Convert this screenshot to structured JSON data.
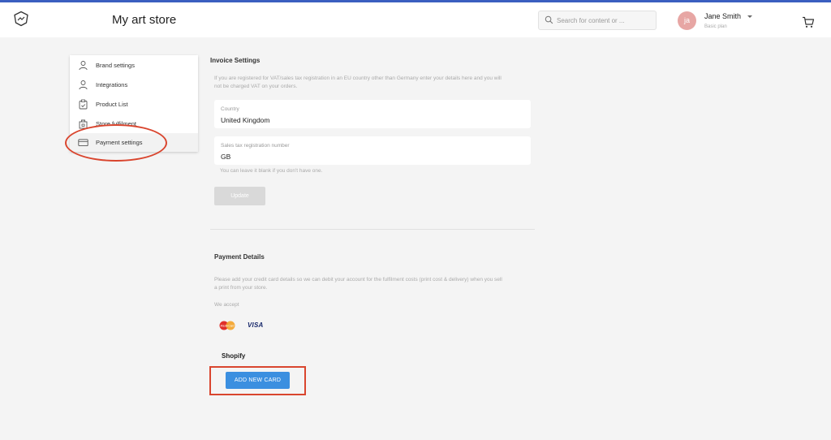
{
  "header": {
    "store_title": "My art store",
    "search": {
      "placeholder": "Search for content or ..."
    },
    "user": {
      "initials": "ja",
      "name": "Jane Smith",
      "plan": "Basic plan"
    }
  },
  "sidebar": {
    "items": [
      {
        "label": "Brand settings",
        "icon": "person-icon"
      },
      {
        "label": "Integrations",
        "icon": "person-icon"
      },
      {
        "label": "Product List",
        "icon": "clipboard-icon"
      },
      {
        "label": "Store fulfilment",
        "icon": "package-icon"
      },
      {
        "label": "Payment settings",
        "icon": "credit-card-icon",
        "active": true
      }
    ]
  },
  "invoice": {
    "title": "Invoice Settings",
    "description_line1": "If you are registered for VAT/sales tax registration in an EU country other than Germany enter your details here and you will",
    "description_line2": "not be charged VAT on your orders.",
    "country_label": "Country",
    "country_value": "United Kingdom",
    "tax_label": "Sales tax registration number",
    "tax_value": "GB",
    "tax_hint": "You can leave it blank if you don't have one.",
    "update_label": "Update"
  },
  "payment": {
    "title": "Payment Details",
    "description_line1": "Please add your credit card details so we can debit your account for the fulfilment costs (print cost & delivery) when you sell",
    "description_line2": "a print from your store.",
    "we_accept": "We accept",
    "mastercard_text": "MasterCard",
    "visa_text": "VISA",
    "shopify_label": "Shopify",
    "add_card_label": "ADD NEW CARD"
  },
  "colors": {
    "accent": "#3b8fe0",
    "top_border": "#3b5fc0",
    "annotation": "#d9452e",
    "avatar": "#e7a6a4"
  }
}
